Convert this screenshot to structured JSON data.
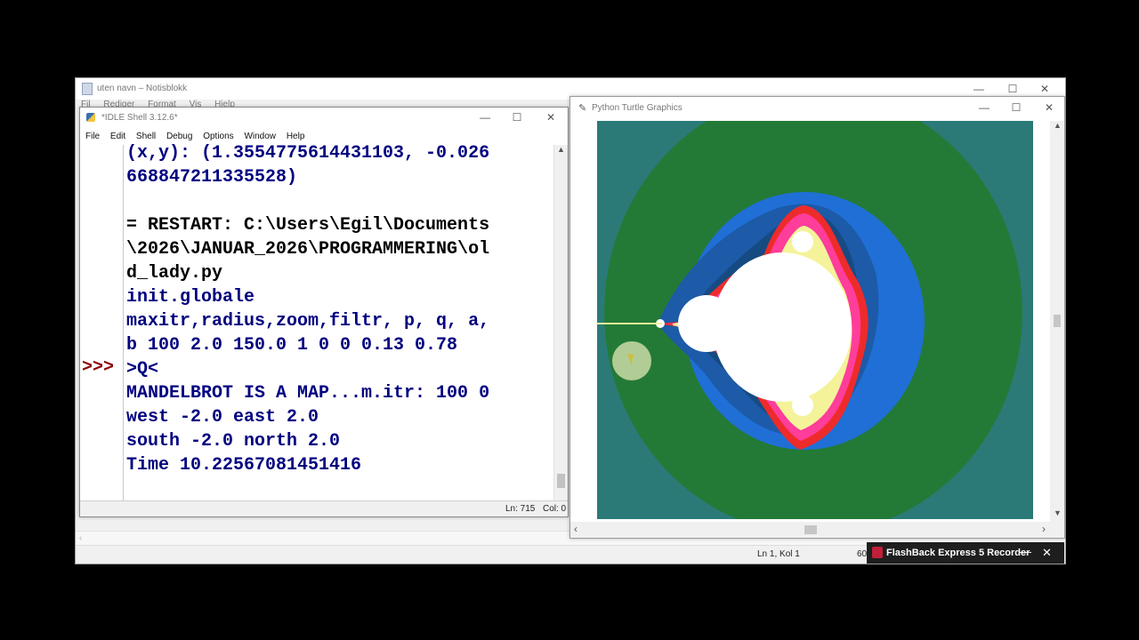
{
  "notepad": {
    "title": "uten navn – Notisblokk",
    "menu": [
      "Fil",
      "Rediger",
      "Format",
      "Vis",
      "Hjelp"
    ],
    "status_position": "Ln 1, Kol 1",
    "status_zoom_partial": "60"
  },
  "idle": {
    "title": "*IDLE Shell 3.12.6*",
    "menu": [
      "File",
      "Edit",
      "Shell",
      "Debug",
      "Options",
      "Window",
      "Help"
    ],
    "prompt": ">>>",
    "lines": [
      "(x,y): (1.3554775614431103, -0.026",
      "668847211335528)",
      "",
      "= RESTART: C:\\Users\\Egil\\Documents",
      "\\2026\\JANUAR_2026\\PROGRAMMERING\\ol",
      "d_lady.py",
      "init.globale",
      "maxitr,radius,zoom,filtr, p, q, a,",
      "b 100 2.0 150.0 1 0 0 0.13 0.78",
      ">Q<",
      "MANDELBROT IS A MAP...m.itr: 100 0",
      "west -2.0 east 2.0",
      "south -2.0 north 2.0",
      "Time 10.22567081451416"
    ],
    "status_ln": "Ln: 715",
    "status_col": "Col: 0"
  },
  "turtle": {
    "title": "Python Turtle Graphics",
    "colors": {
      "outer": "#2b7a78",
      "ring2": "#237a36",
      "ring3": "#1f6fd6",
      "ring4": "#1d5aa8",
      "ring5": "#164b82",
      "edge_red": "#ee2b2b",
      "edge_pink": "#ff3d9a",
      "edge_yellow": "#f4f39a",
      "interior": "#ffffff"
    }
  },
  "flashback": {
    "label": "FlashBack Express 5 Recorder"
  },
  "window_controls": {
    "minimize": "—",
    "maximize": "☐",
    "close": "✕"
  }
}
